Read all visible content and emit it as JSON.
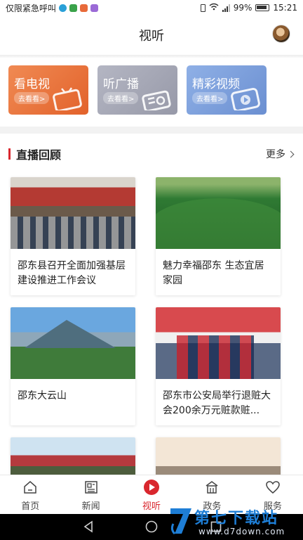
{
  "status_bar": {
    "carrier_text": "仅限紧急呼叫",
    "battery": "99%",
    "time": "15:21"
  },
  "header": {
    "title": "视听"
  },
  "channels": [
    {
      "label": "看电视",
      "sub": "去看看>",
      "icon": "tv-icon",
      "color": "#e8703a"
    },
    {
      "label": "听广播",
      "sub": "去看看>",
      "icon": "radio-icon",
      "color": "#a5a7b5"
    },
    {
      "label": "精彩视频",
      "sub": "去看看>",
      "icon": "video-icon",
      "color": "#7c9fdc"
    }
  ],
  "section": {
    "title": "直播回顾",
    "more": "更多",
    "accent_color": "#d9272e"
  },
  "cards": [
    {
      "title": "邵东县召开全面加强基层建设推进工作会议"
    },
    {
      "title": "魅力幸福邵东 生态宜居家园"
    },
    {
      "title": "邵东大云山"
    },
    {
      "title": "邵东市公安局举行退赃大会200余万元赃款赃..."
    }
  ],
  "bottom_nav": [
    {
      "label": "首页",
      "icon": "home-icon"
    },
    {
      "label": "新闻",
      "icon": "news-icon"
    },
    {
      "label": "视听",
      "icon": "play-icon",
      "active": true
    },
    {
      "label": "政务",
      "icon": "government-icon"
    },
    {
      "label": "服务",
      "icon": "heart-icon"
    }
  ],
  "watermark": {
    "name": "第七下载站",
    "url": "www.d7down.com"
  }
}
